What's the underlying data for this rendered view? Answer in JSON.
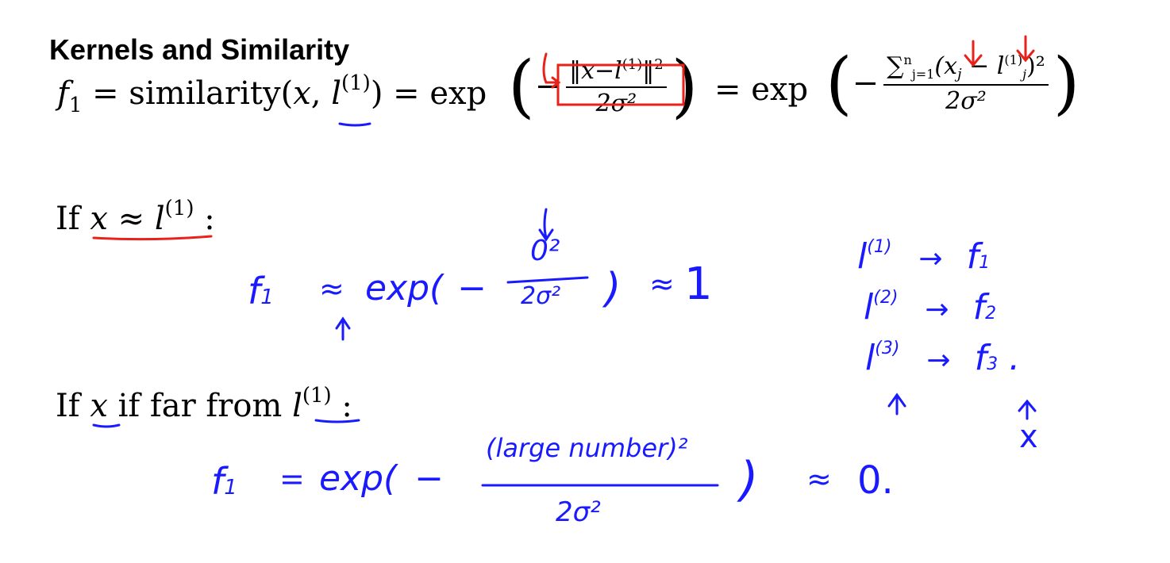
{
  "slide": {
    "title": "Kernels and Similarity",
    "main_equation": {
      "lhs": "f",
      "lhs_sub": "1",
      "eq1": " = similarity(",
      "var_x": "x",
      "comma": ", ",
      "var_l": "l",
      "sup_1": "(1)",
      "close_paren": ")",
      "eq2": " = exp",
      "minus": "−",
      "norm_num": "‖x−l",
      "norm_sup": "(1)",
      "norm_end": "‖",
      "norm_sq": "2",
      "denom": "2σ²",
      "eq3": " = exp",
      "sum_num": "∑",
      "sum_range": "n",
      "sum_index": "j=1",
      "sum_body": "(x",
      "sum_j": "j",
      "sum_minus_l": " − l",
      "sum_l_sup": "(1)",
      "sum_l_sub": "j",
      "sum_close": ")²",
      "denom2": "2σ²"
    },
    "case1": {
      "prefix": "If ",
      "x": "x",
      "approx": " ≈ ",
      "l": "l",
      "sup": "(1)",
      "colon": " :"
    },
    "case2": {
      "prefix": "If ",
      "x": "x",
      "mid": " if far from ",
      "l": "l",
      "sup": "(1)",
      "colon": " :"
    }
  },
  "handwriting": {
    "f1_near": {
      "f": "f",
      "sub": "1",
      "approx": "≈",
      "exp": "exp(",
      "minus": "−",
      "num": "0²",
      "den": "2σ²",
      "close": ")",
      "result_approx": "≈",
      "result": "1"
    },
    "f1_far": {
      "f": "f",
      "sub": "1",
      "eq": "=",
      "exp": "exp(",
      "minus": "−",
      "num": "(large number)²",
      "den": "2σ²",
      "close": ")",
      "result_approx": "≈",
      "result": "0."
    },
    "mapping": [
      {
        "l": "l",
        "sup": "(1)",
        "arrow": "→",
        "f": "f",
        "sub": "1"
      },
      {
        "l": "l",
        "sup": "(2)",
        "arrow": "→",
        "f": "f",
        "sub": "2"
      },
      {
        "l": "l",
        "sup": "(3)",
        "arrow": "→",
        "f": "f",
        "sub": "3",
        "end": "."
      }
    ],
    "x_mark": "x",
    "colors": {
      "blue_ink": "#1a1aff",
      "red_ink": "#e8221a"
    }
  }
}
